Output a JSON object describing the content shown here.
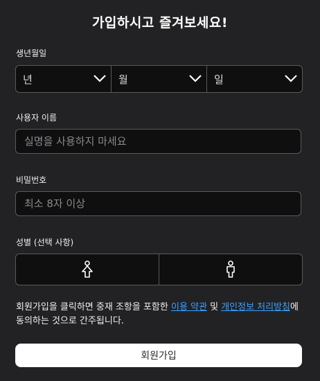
{
  "form": {
    "title": "가입하시고 즐겨보세요!",
    "birth": {
      "label": "생년월일",
      "year_value": "년",
      "month_value": "월",
      "day_value": "일"
    },
    "username": {
      "label": "사용자 이름",
      "placeholder": "실명을 사용하지 마세요"
    },
    "password": {
      "label": "비밀번호",
      "placeholder": "최소 8자 이상"
    },
    "gender": {
      "label": "성별 (선택 사항)",
      "options": [
        {
          "icon": "male-icon"
        },
        {
          "icon": "female-icon"
        }
      ]
    },
    "terms": {
      "prefix": "회원가입을 클릭하면 중재 조항을 포함한 ",
      "link_terms": "이용 약관",
      "middle": " 및 ",
      "link_privacy": "개인정보 처리방침",
      "suffix": "에 동의하는 것으로 간주됩니다."
    },
    "submit_label": "회원가입"
  },
  "colors": {
    "background": "#222224",
    "field_bg": "#0f0f10",
    "border": "#5a5a5e",
    "link": "#3aa0ff",
    "button_bg": "#ffffff"
  }
}
